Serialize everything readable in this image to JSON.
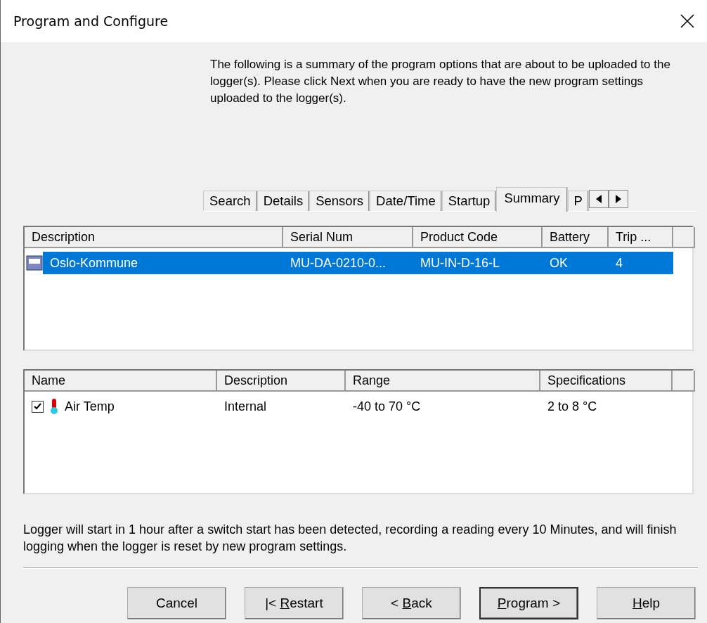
{
  "window": {
    "title": "Program and Configure"
  },
  "intro": "The following is a summary of the program options that are about to be uploaded to the logger(s). Please click Next when you are ready to have the new program settings uploaded to the logger(s).",
  "tabs": [
    {
      "label": "Search",
      "selected": false
    },
    {
      "label": "Details",
      "selected": false
    },
    {
      "label": "Sensors",
      "selected": false
    },
    {
      "label": "Date/Time",
      "selected": false
    },
    {
      "label": "Startup",
      "selected": false
    },
    {
      "label": "Summary",
      "selected": true
    },
    {
      "label": "P",
      "selected": false
    }
  ],
  "loggers": {
    "columns": [
      "Description",
      "Serial Num",
      "Product Code",
      "Battery",
      "Trip ..."
    ],
    "rows": [
      {
        "cells": [
          "Oslo-Kommune",
          "MU-DA-0210-0...",
          "MU-IN-D-16-L",
          "OK",
          "4"
        ],
        "selected": true
      }
    ]
  },
  "sensors": {
    "columns": [
      "Name",
      "Description",
      "Range",
      "Specifications"
    ],
    "rows": [
      {
        "cells": [
          "Air Temp",
          "Internal",
          "-40 to 70 °C",
          "2 to 8 °C"
        ],
        "checked": true
      }
    ]
  },
  "summary": "Logger will start in 1 hour after a switch start has been detected, recording a reading every 10 Minutes, and will finish logging when the logger is reset by new program settings.",
  "buttons": [
    {
      "before": "Cancel",
      "default": false
    },
    {
      "before": "|< ",
      "key": "R",
      "after": "estart",
      "default": false
    },
    {
      "before": "< ",
      "key": "B",
      "after": "ack",
      "default": false
    },
    {
      "key": "P",
      "after": "rogram >",
      "default": true
    },
    {
      "key": "H",
      "after": "elp",
      "default": false
    }
  ]
}
